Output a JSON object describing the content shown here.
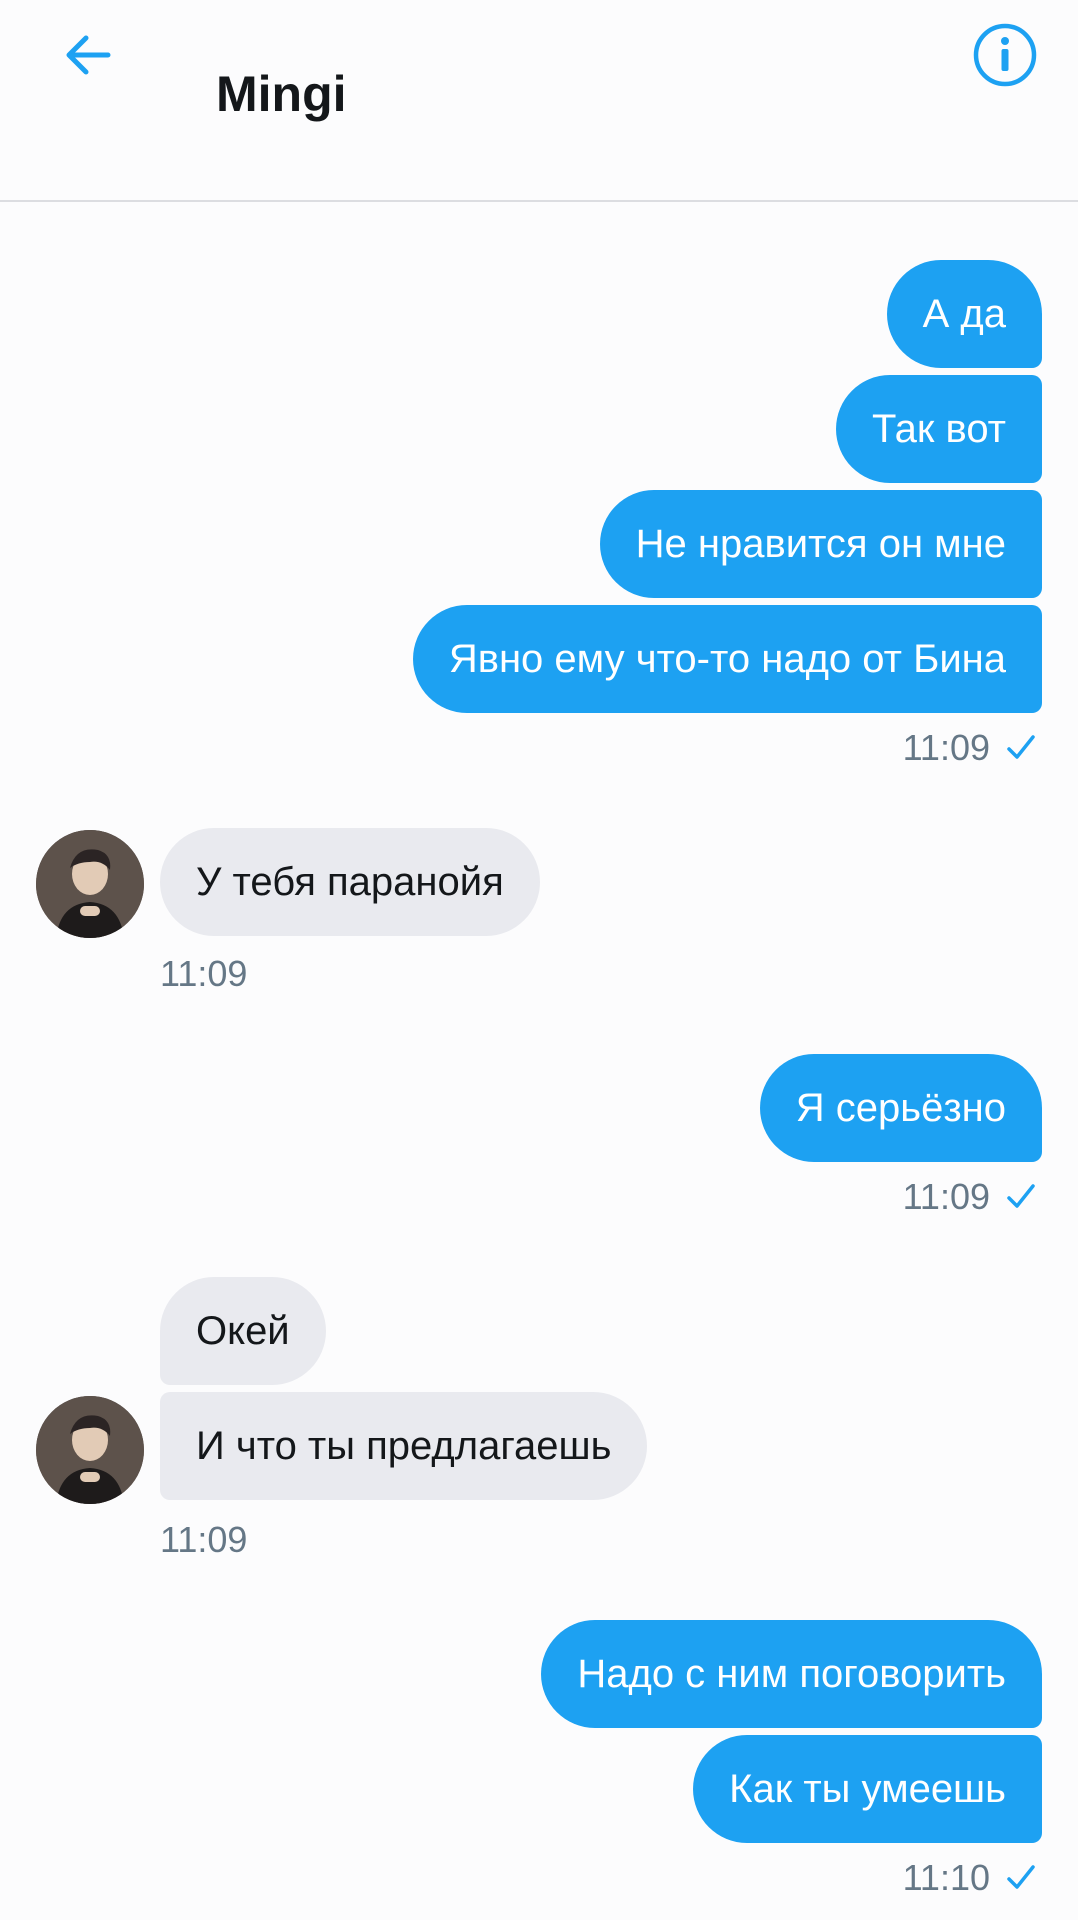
{
  "header": {
    "title": "Mingi"
  },
  "icons": {
    "back": "arrow-left-icon",
    "info": "info-circle-icon",
    "read_receipt": "checkmark-icon"
  },
  "colors": {
    "accent": "#1da1f2",
    "incoming_bubble": "#e9eaef",
    "timestamp": "#657786"
  },
  "messages": [
    {
      "direction": "out",
      "text": "А да"
    },
    {
      "direction": "out",
      "text": "Так вот"
    },
    {
      "direction": "out",
      "text": "Не нравится он мне"
    },
    {
      "direction": "out",
      "text": "Явно ему что-то надо от Бина"
    },
    {
      "direction": "in",
      "text": "У тебя паранойя"
    },
    {
      "direction": "out",
      "text": "Я серьёзно"
    },
    {
      "direction": "in",
      "text": "Окей"
    },
    {
      "direction": "in",
      "text": "И что ты предлагаешь"
    },
    {
      "direction": "out",
      "text": "Надо с ним поговорить"
    },
    {
      "direction": "out",
      "text": "Как ты умеешь"
    }
  ],
  "timestamps": [
    "11:09",
    "11:09",
    "11:09",
    "11:09",
    "11:10"
  ]
}
